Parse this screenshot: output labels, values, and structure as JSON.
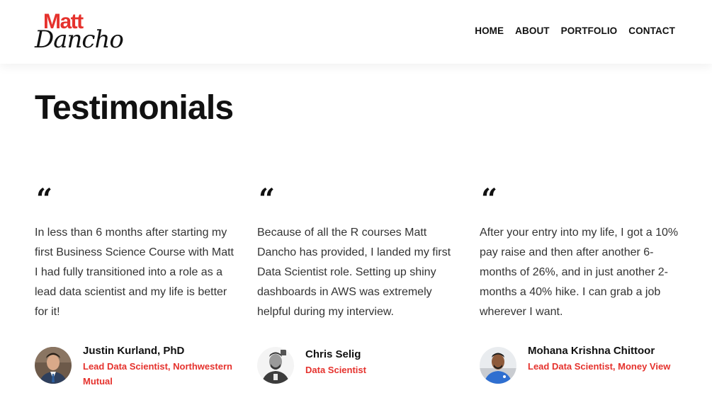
{
  "colors": {
    "accent": "#e5322d",
    "text": "#111111",
    "body_text": "#333333"
  },
  "logo": {
    "top": "Matt",
    "bottom": "Dancho"
  },
  "nav": {
    "items": [
      "HOME",
      "ABOUT",
      "PORTFOLIO",
      "CONTACT"
    ]
  },
  "page_title": "Testimonials",
  "testimonials": [
    {
      "quote_mark": "“",
      "text": "In less than 6 months after starting my first Business Science Course with Matt I had fully transitioned into a role as a lead data scientist and my life is better for it!",
      "name": "Justin Kurland, PhD",
      "role": "Lead Data Scientist, Northwestern Mutual",
      "avatar": "person-avatar"
    },
    {
      "quote_mark": "“",
      "text": "Because of all the R courses Matt Dancho has provided, I landed my first Data Scientist role. Setting up shiny dashboards in AWS was extremely helpful during my interview.",
      "name": "Chris Selig",
      "role": "Data Scientist",
      "avatar": "person-avatar"
    },
    {
      "quote_mark": "“",
      "text": "After your entry into my life, I got a 10% pay raise and then after another 6-months of 26%, and in just another 2-months a 40% hike. I can grab a job wherever I want.",
      "name": "Mohana Krishna Chittoor",
      "role": "Lead Data Scientist, Money View",
      "avatar": "person-avatar"
    }
  ]
}
